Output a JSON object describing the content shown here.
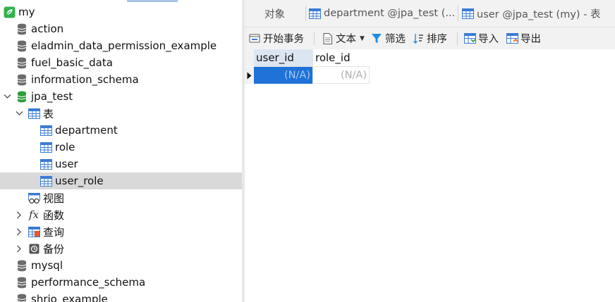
{
  "sidebar": {
    "connection": "my",
    "databases_top": [
      "action",
      "eladmin_data_permission_example",
      "fuel_basic_data",
      "information_schema"
    ],
    "open_database": "jpa_test",
    "tables_group": "表",
    "tables": [
      "department",
      "role",
      "user",
      "user_role"
    ],
    "selected_table": "user_role",
    "views_group": "视图",
    "functions_group": "函数",
    "queries_group": "查询",
    "backups_group": "备份",
    "databases_bottom": [
      "mysql",
      "performance_schema",
      "shrio_example"
    ]
  },
  "tabs": {
    "objects": "对象",
    "tab1": "department @jpa_test (...",
    "tab2": "user @jpa_test (my) - 表"
  },
  "toolbar": {
    "begin_transaction": "开始事务",
    "text": "文本",
    "filter": "筛选",
    "sort": "排序",
    "import": "导入",
    "export": "导出"
  },
  "grid": {
    "columns": [
      "user_id",
      "role_id"
    ],
    "rows": [
      [
        "(N/A)",
        "(N/A)"
      ]
    ]
  },
  "colors": {
    "db_icon": "#6b6b6b",
    "db_open": "#2e9e3a",
    "table_icon": "#3a7bd5",
    "selection": "#d9d9d9",
    "cell_selected": "#1e72d8"
  }
}
